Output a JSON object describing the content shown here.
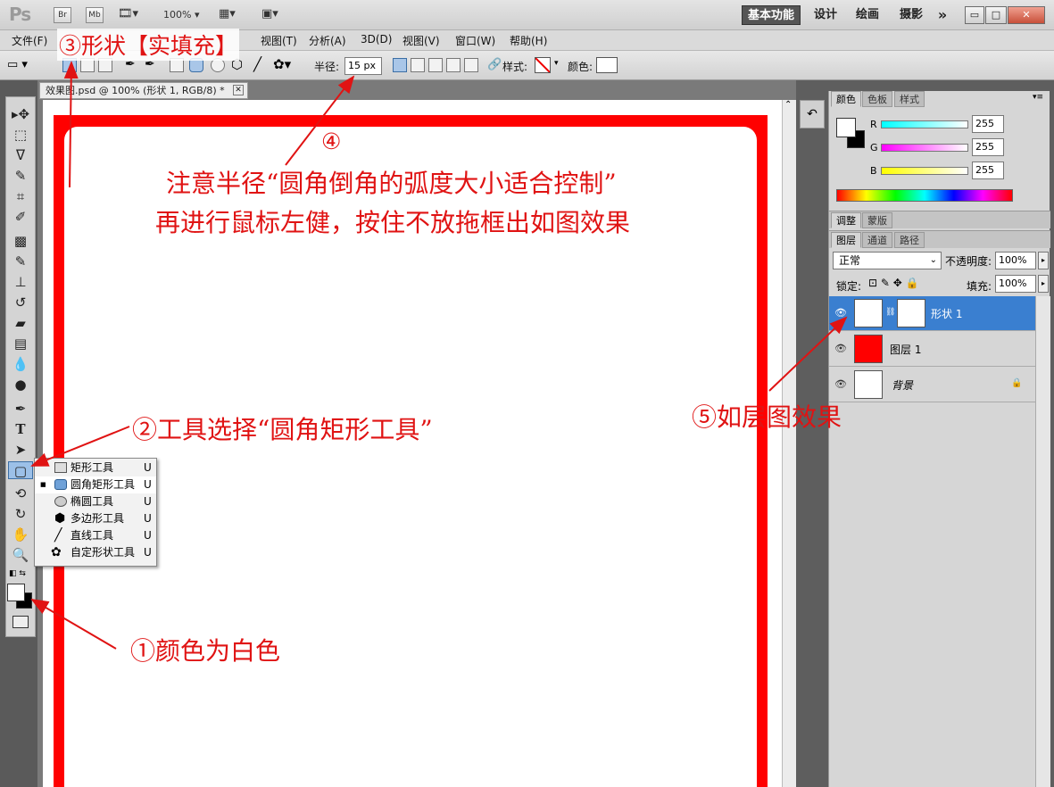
{
  "titlebar": {
    "logo": "Ps",
    "br": "Br",
    "mb": "Mb",
    "zoom": "100%",
    "workspaces": [
      "基本功能",
      "设计",
      "绘画",
      "摄影"
    ],
    "more": "»",
    "min": "▭",
    "max": "□",
    "close": "✕"
  },
  "menubar": {
    "items": [
      "文件(F)",
      "视图(T)",
      "分析(A)",
      "3D(D)",
      "视图(V)",
      "窗口(W)",
      "帮助(H)"
    ]
  },
  "options": {
    "radius_label": "半径:",
    "radius_value": "15 px",
    "style_label": "样式:",
    "color_label": "颜色:"
  },
  "document": {
    "tab_title": "效果图.psd @ 100% (形状 1, RGB/8) *",
    "tab_close": "✕"
  },
  "color_panel": {
    "tabs": [
      "颜色",
      "色板",
      "样式"
    ],
    "channels": [
      {
        "label": "R",
        "value": "255"
      },
      {
        "label": "G",
        "value": "255"
      },
      {
        "label": "B",
        "value": "255"
      }
    ]
  },
  "adjust_panel": {
    "tabs": [
      "调整",
      "蒙版"
    ]
  },
  "layers_panel": {
    "tabs": [
      "图层",
      "通道",
      "路径"
    ],
    "blend_mode": "正常",
    "opacity_label": "不透明度:",
    "opacity": "100%",
    "lock_label": "锁定:",
    "fill_label": "填充:",
    "fill": "100%",
    "layers": [
      {
        "name": "形状 1"
      },
      {
        "name": "图层 1"
      },
      {
        "name": "背景"
      }
    ]
  },
  "tool_flyout": {
    "items": [
      {
        "label": "矩形工具",
        "key": "U"
      },
      {
        "label": "圆角矩形工具",
        "key": "U"
      },
      {
        "label": "椭圆工具",
        "key": "U"
      },
      {
        "label": "多边形工具",
        "key": "U"
      },
      {
        "label": "直线工具",
        "key": "U"
      },
      {
        "label": "自定形状工具",
        "key": "U"
      }
    ],
    "active_marker": "■"
  },
  "annotations": {
    "step1": "①颜色为白色",
    "step2": "②工具选择“圆角矩形工具”",
    "step3": "③形状【实填充】",
    "step4": "④",
    "step4_line1": "注意半径“圆角倒角的弧度大小适合控制”",
    "step4_line2": "再进行鼠标左健，按住不放拖框出如图效果",
    "step5": "⑤如层图效果"
  },
  "colors": {
    "annotation_red": "#e01313",
    "layer_red": "#ff0000",
    "selected_layer_blue": "#3a7fd0"
  }
}
